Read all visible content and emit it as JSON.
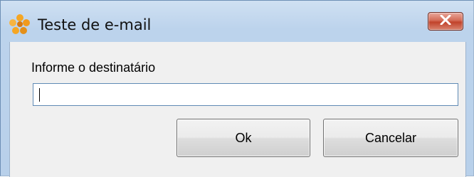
{
  "window": {
    "title": "Teste de e-mail",
    "icon": "app-flower-icon",
    "close_icon": "close-icon"
  },
  "form": {
    "label": "Informe o destinatário",
    "recipient_value": "",
    "recipient_placeholder": ""
  },
  "buttons": {
    "ok_label": "Ok",
    "cancel_label": "Cancelar"
  },
  "colors": {
    "title_bar": "#bcd3ec",
    "close_button": "#c1432b",
    "client_background": "#f0f0f0",
    "app_icon": "#f0a030"
  }
}
